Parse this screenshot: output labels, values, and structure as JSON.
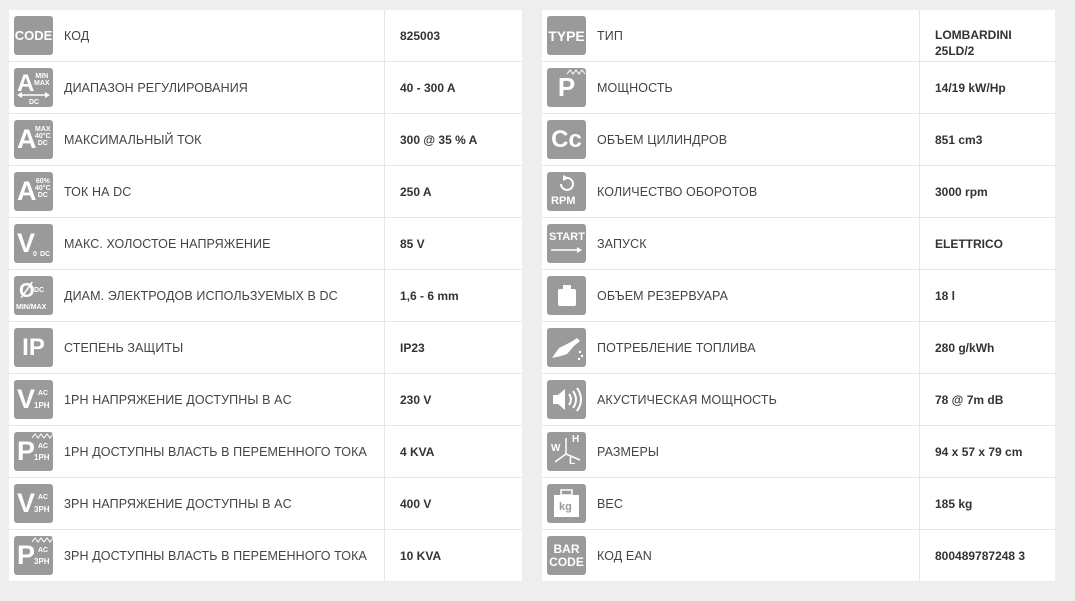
{
  "left_table": [
    {
      "icon_text": "CODE",
      "icon": "code-icon",
      "label": "КОД",
      "value": "825003"
    },
    {
      "icon_text": "A",
      "icon_sub": "MIN MAX DC",
      "icon": "amp-range-icon",
      "label": "ДИАПАЗОН РЕГУЛИРОВАНИЯ",
      "value": "40 - 300 A"
    },
    {
      "icon_text": "A",
      "icon_sub": "MAX 40°C DC",
      "icon": "max-current-icon",
      "label": "МАКСИМАЛЬНЫЙ ТОК",
      "value": "300 @ 35 % A"
    },
    {
      "icon_text": "A",
      "icon_sub": "60% 40°C DC",
      "icon": "dc-current-icon",
      "label": "ТОК НА DC",
      "value": "250 A"
    },
    {
      "icon_text": "V",
      "icon_sub": "0 DC",
      "icon": "voltage-icon",
      "label": "МАКС. ХОЛОСТОЕ НАПРЯЖЕНИЕ",
      "value": "85 V"
    },
    {
      "icon_text": "Ø",
      "icon_sub": "DC MIN/MAX",
      "icon": "electrode-diameter-icon",
      "label": "ДИАМ. ЭЛЕКТРОДОВ ИСПОЛЬЗУЕМЫХ В DC",
      "value": "1,6 - 6 mm"
    },
    {
      "icon_text": "IP",
      "icon": "ip-protection-icon",
      "label": "СТЕПЕНЬ ЗАЩИТЫ",
      "value": "IP23"
    },
    {
      "icon_text": "V",
      "icon_sub": "AC 1PH",
      "icon": "voltage-1ph-icon",
      "label": "1PH НАПРЯЖЕНИЕ ДОСТУПНЫ В AC",
      "value": "230 V"
    },
    {
      "icon_text": "P",
      "icon_sub": "AC 1PH",
      "icon": "power-1ph-icon",
      "label": "1PH  ДОСТУПНЫ ВЛАСТЬ В ПЕРЕМЕННОГО ТОКА",
      "value": "4 KVA"
    },
    {
      "icon_text": "V",
      "icon_sub": "AC 3PH",
      "icon": "voltage-3ph-icon",
      "label": "3PH НАПРЯЖЕНИЕ ДОСТУПНЫ В AC",
      "value": "400 V"
    },
    {
      "icon_text": "P",
      "icon_sub": "AC 3PH",
      "icon": "power-3ph-icon",
      "label": "3PH  ДОСТУПНЫ ВЛАСТЬ В ПЕРЕМЕННОГО ТОКА",
      "value": "10 KVA"
    }
  ],
  "right_table": [
    {
      "icon_text": "TYPE",
      "icon": "type-icon",
      "label": "ТИП",
      "value": "LOMBARDINI\n25LD/2"
    },
    {
      "icon_text": "P",
      "icon": "power-icon",
      "label": "МОЩНОСТЬ",
      "value": "14/19 kW/Hp"
    },
    {
      "icon_text": "Cc",
      "icon": "cylinder-volume-icon",
      "label": "ОБЪЕМ ЦИЛИНДРОВ",
      "value": "851 cm3"
    },
    {
      "icon_text": "RPM",
      "icon": "rpm-icon",
      "label": "КОЛИЧЕСТВО ОБОРОТОВ",
      "value": "3000 rpm"
    },
    {
      "icon_text": "START",
      "icon": "start-icon",
      "label": "ЗАПУСК",
      "value": "ELETTRICO"
    },
    {
      "icon_text": "",
      "icon": "fuel-tank-icon",
      "label": "ОБЪЕМ РЕЗЕРВУАРА",
      "value": "18 l"
    },
    {
      "icon_text": "",
      "icon": "fuel-nozzle-icon",
      "label": "ПОТРЕБЛЕНИЕ ТОПЛИВА",
      "value": "280 g/kWh"
    },
    {
      "icon_text": "",
      "icon": "speaker-icon",
      "label": "АКУСТИЧЕСКАЯ МОЩНОСТЬ",
      "value": "78 @ 7m dB"
    },
    {
      "icon_text": "W H L",
      "icon": "dimensions-icon",
      "label": "РАЗМЕРЫ",
      "value": "94 x 57 x 79 cm"
    },
    {
      "icon_text": "kg",
      "icon": "weight-icon",
      "label": "ВЕС",
      "value": "185 kg"
    },
    {
      "icon_text": "BAR CODE",
      "icon": "barcode-icon",
      "label": "КОД EAN",
      "value": "800489787248 3"
    }
  ]
}
